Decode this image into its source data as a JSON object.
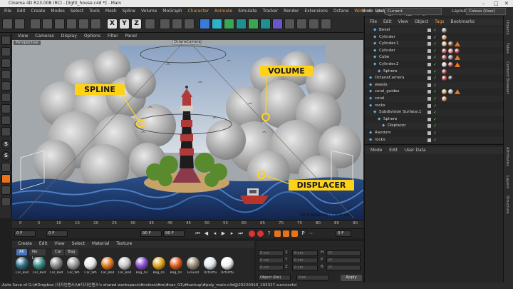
{
  "titlebar": {
    "title": "Cinema 4D R23.008 (RC) - [light_house.c4d *] - Main"
  },
  "menubar": {
    "items": [
      "File",
      "Edit",
      "Create",
      "Modes",
      "Select",
      "Tools",
      "Mesh",
      "Spline",
      "Volume",
      "MoGraph",
      "Character",
      "Animate",
      "Simulate",
      "Tracker",
      "Render",
      "Extensions",
      "Octane",
      "Window",
      "Help"
    ],
    "node_space_label": "Node Space:",
    "node_space_value": "Current (Standard/Physical)",
    "layout_label": "Layout:",
    "layout_value": "Coloso (User)"
  },
  "toolbar": {
    "x_label": "X",
    "y_label": "Y",
    "z_label": "Z"
  },
  "viewport": {
    "menu": [
      "View",
      "Cameras",
      "Display",
      "Options",
      "Filter",
      "Panel"
    ],
    "label": "Perspective",
    "camera_label": "OctaneCamera",
    "grid_spacing": "Grid Spacing : 1000 cm",
    "callouts": {
      "spline": "SPLINE",
      "volume": "VOLUME",
      "displacer": "DISPLACER"
    }
  },
  "timeline": {
    "ticks": [
      "0",
      "5",
      "10",
      "15",
      "20",
      "25",
      "30",
      "35",
      "40",
      "45",
      "50",
      "55",
      "60",
      "65",
      "70",
      "75",
      "80",
      "85",
      "90"
    ]
  },
  "playback": {
    "frame_start": "0 F",
    "frame_current": "0 F",
    "frame_end": "90 F",
    "frame_end2": "90 F",
    "frame_right": "0 F"
  },
  "materials": {
    "menu": [
      "Create",
      "Edit",
      "View",
      "Select",
      "Material",
      "Texture"
    ],
    "tabs": [
      "All",
      "No Layer",
      "Car",
      "Bag"
    ],
    "items": [
      {
        "label": "Car_Bod",
        "color": "#2f6f8a"
      },
      {
        "label": "Car_Bod",
        "color": "#3a8a86"
      },
      {
        "label": "Car_Bod",
        "color": "#888888"
      },
      {
        "label": "Car_Wh",
        "color": "#9a9a9a"
      },
      {
        "label": "Car_Wh",
        "color": "#e8e8e8"
      },
      {
        "label": "Car_Bod",
        "color": "#e07a1e"
      },
      {
        "label": "Car_Bod",
        "color": "#c8c8c8"
      },
      {
        "label": "Bag_02",
        "color": "#8a4fd1"
      },
      {
        "label": "Bag_01",
        "color": "#e0a61e"
      },
      {
        "label": "Bag_01",
        "color": "#e25a1a"
      },
      {
        "label": "Ground",
        "color": "#9a8a7a"
      },
      {
        "label": "OctDiffu",
        "color": "#dfe8ee"
      },
      {
        "label": "OctDiffu",
        "color": "#f2f2f2"
      }
    ]
  },
  "coords": {
    "labels": [
      "X",
      "Y",
      "Z"
    ],
    "field_value": "0 cm",
    "rot_labels": [
      "H",
      "P",
      "B"
    ],
    "rot_value": "0°",
    "mode_value": "Object (Rel)",
    "size_value": "Size",
    "apply": "Apply"
  },
  "object_manager": {
    "menu": [
      "File",
      "Edit",
      "View",
      "Object",
      "Tags",
      "Bookmarks"
    ],
    "rows": [
      {
        "name": "Bevel",
        "indent": 1,
        "tags": [
          "#888"
        ]
      },
      {
        "name": "Cylinder",
        "indent": 1,
        "tags": [
          "#c98a5a"
        ]
      },
      {
        "name": "Cylinder.1",
        "indent": 1,
        "tags": [
          "#d9b08c",
          "#8a5a3a",
          "orange"
        ]
      },
      {
        "name": "Cylinder",
        "indent": 1,
        "tags": [
          "#b05050",
          "#d97a7a",
          "#a04040"
        ]
      },
      {
        "name": "Cube",
        "indent": 1,
        "tags": [
          "#b05050",
          "#777",
          "orange"
        ]
      },
      {
        "name": "Cylinder.2",
        "indent": 1,
        "tags": [
          "#c0c0c0",
          "#a04040",
          "orange"
        ]
      },
      {
        "name": "Sphere",
        "indent": 2,
        "tags": [
          "#a04040"
        ]
      },
      {
        "name": "OctaneCamera",
        "indent": 0,
        "tags": [
          "#c04040",
          "#333"
        ]
      },
      {
        "name": "weeds",
        "indent": 0,
        "tags": []
      },
      {
        "name": "coral_guides",
        "indent": 0,
        "tags": [
          "#c8a060",
          "#a0a0a0",
          "orange"
        ]
      },
      {
        "name": "coral",
        "indent": 0,
        "tags": [
          "#c98a5a"
        ]
      },
      {
        "name": "rocks",
        "indent": 0,
        "tags": []
      },
      {
        "name": "Subdivision Surface.1",
        "indent": 1,
        "tags": []
      },
      {
        "name": "Sphere",
        "indent": 2,
        "tags": []
      },
      {
        "name": "Displacer",
        "indent": 3,
        "tags": []
      },
      {
        "name": "Random",
        "indent": 0,
        "tags": []
      },
      {
        "name": "rocks",
        "indent": 0,
        "tags": []
      }
    ]
  },
  "attributes": {
    "menu": [
      "Mode",
      "Edit",
      "User Data"
    ]
  },
  "right_tabs": [
    "Objects",
    "Takes",
    "Content Browser",
    "Attributes",
    "Layers",
    "Structure"
  ],
  "statusbar": {
    "text": "Auto Save of G:\\#Dropbox (디자인벤스)\\#디자인벤스's shared workspace\\#coloso\\#re\\#sec_01\\#backup\\#poly_main.c4d@20220410_193327 successful"
  }
}
